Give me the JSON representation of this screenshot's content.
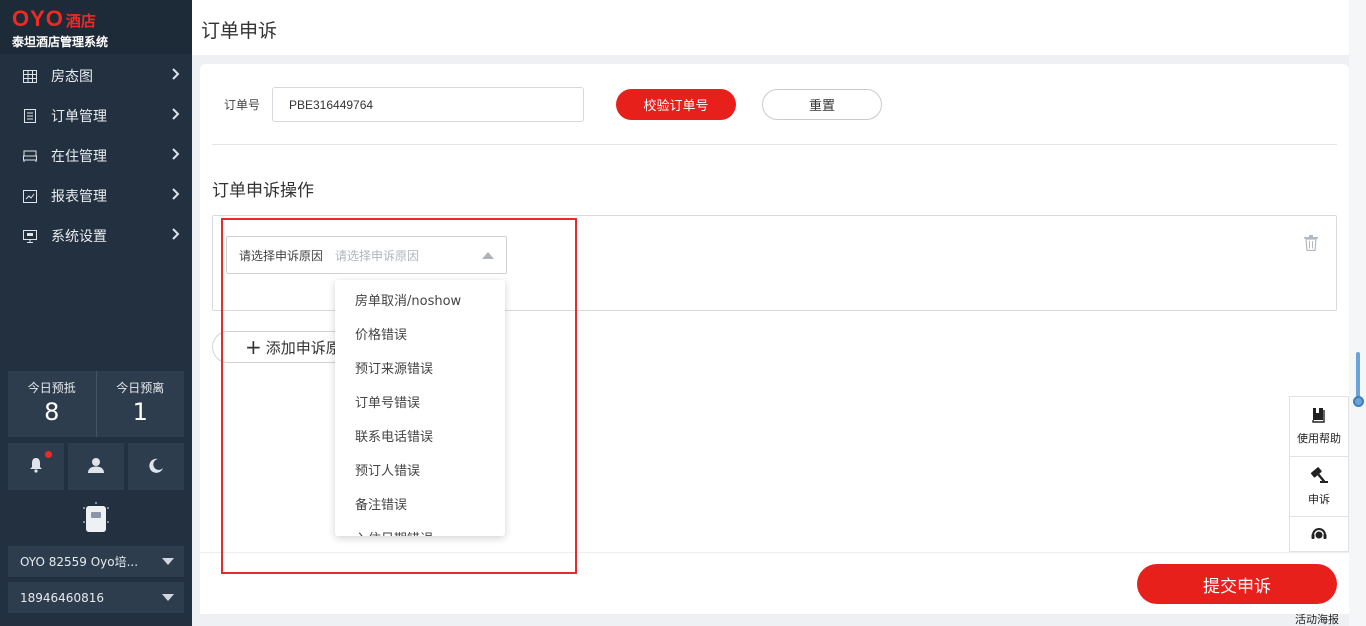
{
  "brand": {
    "logo": "OYO",
    "logo_suffix": "酒店",
    "subtitle": "泰坦酒店管理系统"
  },
  "sidebar": {
    "nav": [
      {
        "label": "房态图",
        "icon": "grid-icon"
      },
      {
        "label": "订单管理",
        "icon": "document-icon"
      },
      {
        "label": "在住管理",
        "icon": "bed-icon"
      },
      {
        "label": "报表管理",
        "icon": "chart-icon"
      },
      {
        "label": "系统设置",
        "icon": "monitor-icon"
      }
    ],
    "stats": [
      {
        "title": "今日预抵",
        "value": "8"
      },
      {
        "title": "今日预离",
        "value": "1"
      }
    ],
    "hotel_select": "OYO 82559 Oyo培...",
    "phone_select": "18946460816"
  },
  "header": {
    "title": "订单申诉"
  },
  "form": {
    "order_label": "订单号",
    "order_value": "PBE316449764",
    "verify_button": "校验订单号",
    "reset_button": "重置",
    "section_title": "订单申诉操作",
    "reason_label": "请选择申诉原因",
    "reason_placeholder": "请选择申诉原因",
    "add_reason_button": "添加申诉原因",
    "submit_button": "提交申诉"
  },
  "dropdown": {
    "options": [
      "房单取消/noshow",
      "价格错误",
      "预订来源错误",
      "订单号错误",
      "联系电话错误",
      "预订人错误",
      "备注错误",
      "入住日期错误"
    ]
  },
  "tools": {
    "help": "使用帮助",
    "appeal": "申诉",
    "activity": "活动海报"
  },
  "colors": {
    "accent": "#e8201c",
    "sidebar": "#223040",
    "highlight": "#e52b2b"
  }
}
